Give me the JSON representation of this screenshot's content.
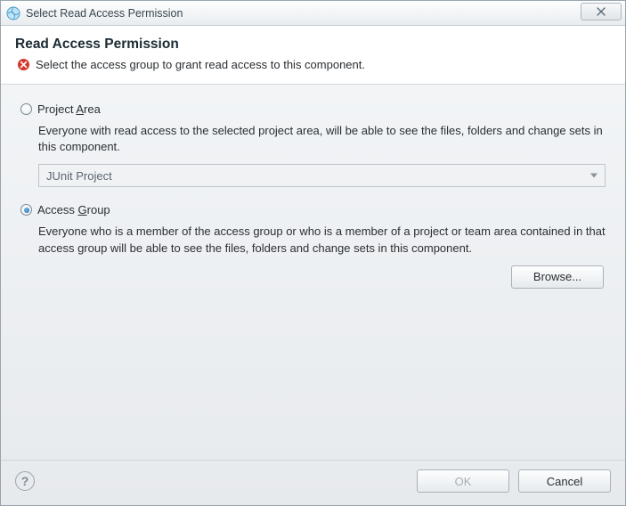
{
  "window": {
    "title": "Select Read Access Permission"
  },
  "header": {
    "heading": "Read Access Permission",
    "status_message": "Select the access group to grant read access to this component."
  },
  "options": {
    "project_area": {
      "label_pre": "Project ",
      "label_mn": "A",
      "label_post": "rea",
      "description": "Everyone with read access to the selected project area, will be able to see the files, folders and change sets in this component.",
      "selected_value": "JUnit Project",
      "checked": false
    },
    "access_group": {
      "label_pre": "Access ",
      "label_mn": "G",
      "label_post": "roup",
      "description": "Everyone who is a member of the access group or who is a member of a project or team area contained in that access group will be able to see the files, folders and change sets in this component.",
      "browse_label": "Browse...",
      "checked": true
    }
  },
  "footer": {
    "ok_label": "OK",
    "cancel_label": "Cancel"
  }
}
